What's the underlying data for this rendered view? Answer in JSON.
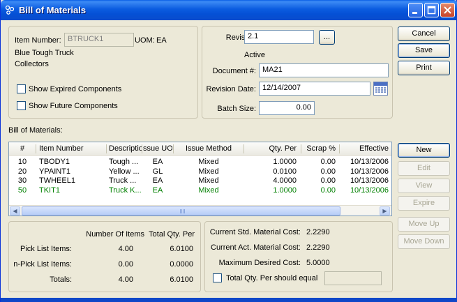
{
  "window": {
    "title": "Bill of Materials",
    "minimize_icon": "minimize-icon",
    "maximize_icon": "maximize-icon",
    "close_icon": "close-icon",
    "app_icon": "app-icon"
  },
  "item": {
    "number_label": "Item Number:",
    "number_value": "BTRUCK1",
    "uom_label": "UOM:",
    "uom_value": "EA",
    "desc1": "Blue Tough Truck",
    "desc2": "Collectors",
    "show_expired": "Show Expired Components",
    "show_future": "Show Future Components"
  },
  "revision": {
    "revision_label": "Revision:",
    "revision_value": "2.1",
    "lookup_button": "...",
    "status": "Active",
    "document_label": "Document #:",
    "document_value": "MA21",
    "date_label": "Revision Date:",
    "date_value": "12/14/2007",
    "calendar_icon": "calendar-icon",
    "batch_label": "Batch Size:",
    "batch_value": "0.00"
  },
  "actions": {
    "cancel": "Cancel",
    "save": "Save",
    "print": "Print"
  },
  "bom": {
    "section_label": "Bill of Materials:",
    "columns": [
      "#",
      "Item Number",
      "Descriptio",
      "ssue UO",
      "Issue Method",
      "Qty. Per",
      "Scrap %",
      "Effective"
    ],
    "rows": [
      {
        "num": "10",
        "item": "TBODY1",
        "desc": "Tough ...",
        "uom": "EA",
        "method": "Mixed",
        "qty": "1.0000",
        "scrap": "0.00",
        "effective": "10/13/2006",
        "green": false
      },
      {
        "num": "20",
        "item": "YPAINT1",
        "desc": "Yellow ...",
        "uom": "GL",
        "method": "Mixed",
        "qty": "0.0100",
        "scrap": "0.00",
        "effective": "10/13/2006",
        "green": false
      },
      {
        "num": "30",
        "item": "TWHEEL1",
        "desc": "Truck ...",
        "uom": "EA",
        "method": "Mixed",
        "qty": "4.0000",
        "scrap": "0.00",
        "effective": "10/13/2006",
        "green": false
      },
      {
        "num": "50",
        "item": "TKIT1",
        "desc": "Truck K...",
        "uom": "EA",
        "method": "Mixed",
        "qty": "1.0000",
        "scrap": "0.00",
        "effective": "10/13/2006",
        "green": true
      }
    ],
    "scroll_left_icon": "scroll-left-icon",
    "scroll_right_icon": "scroll-right-icon",
    "scroll_thumb_grip_icon": "grip-icon"
  },
  "side_buttons": {
    "new": "New",
    "edit": "Edit",
    "view": "View",
    "expire": "Expire",
    "move_up": "Move Up",
    "move_down": "Move Down"
  },
  "totals": {
    "col_items": "Number Of Items",
    "col_qty": "Total Qty. Per",
    "pick_label": "Pick List Items:",
    "pick_items": "4.00",
    "pick_qty": "6.0100",
    "nonpick_label": "n-Pick List Items:",
    "nonpick_items": "0.00",
    "nonpick_qty": "0.0000",
    "totals_label": "Totals:",
    "totals_items": "4.00",
    "totals_qty": "6.0100"
  },
  "costs": {
    "std_label": "Current Std. Material Cost:",
    "std_value": "2.2290",
    "act_label": "Current Act. Material Cost:",
    "act_value": "2.2290",
    "max_label": "Maximum Desired Cost:",
    "max_value": "5.0000",
    "total_equal_label": "Total Qty. Per should equal",
    "total_equal_value": ""
  }
}
